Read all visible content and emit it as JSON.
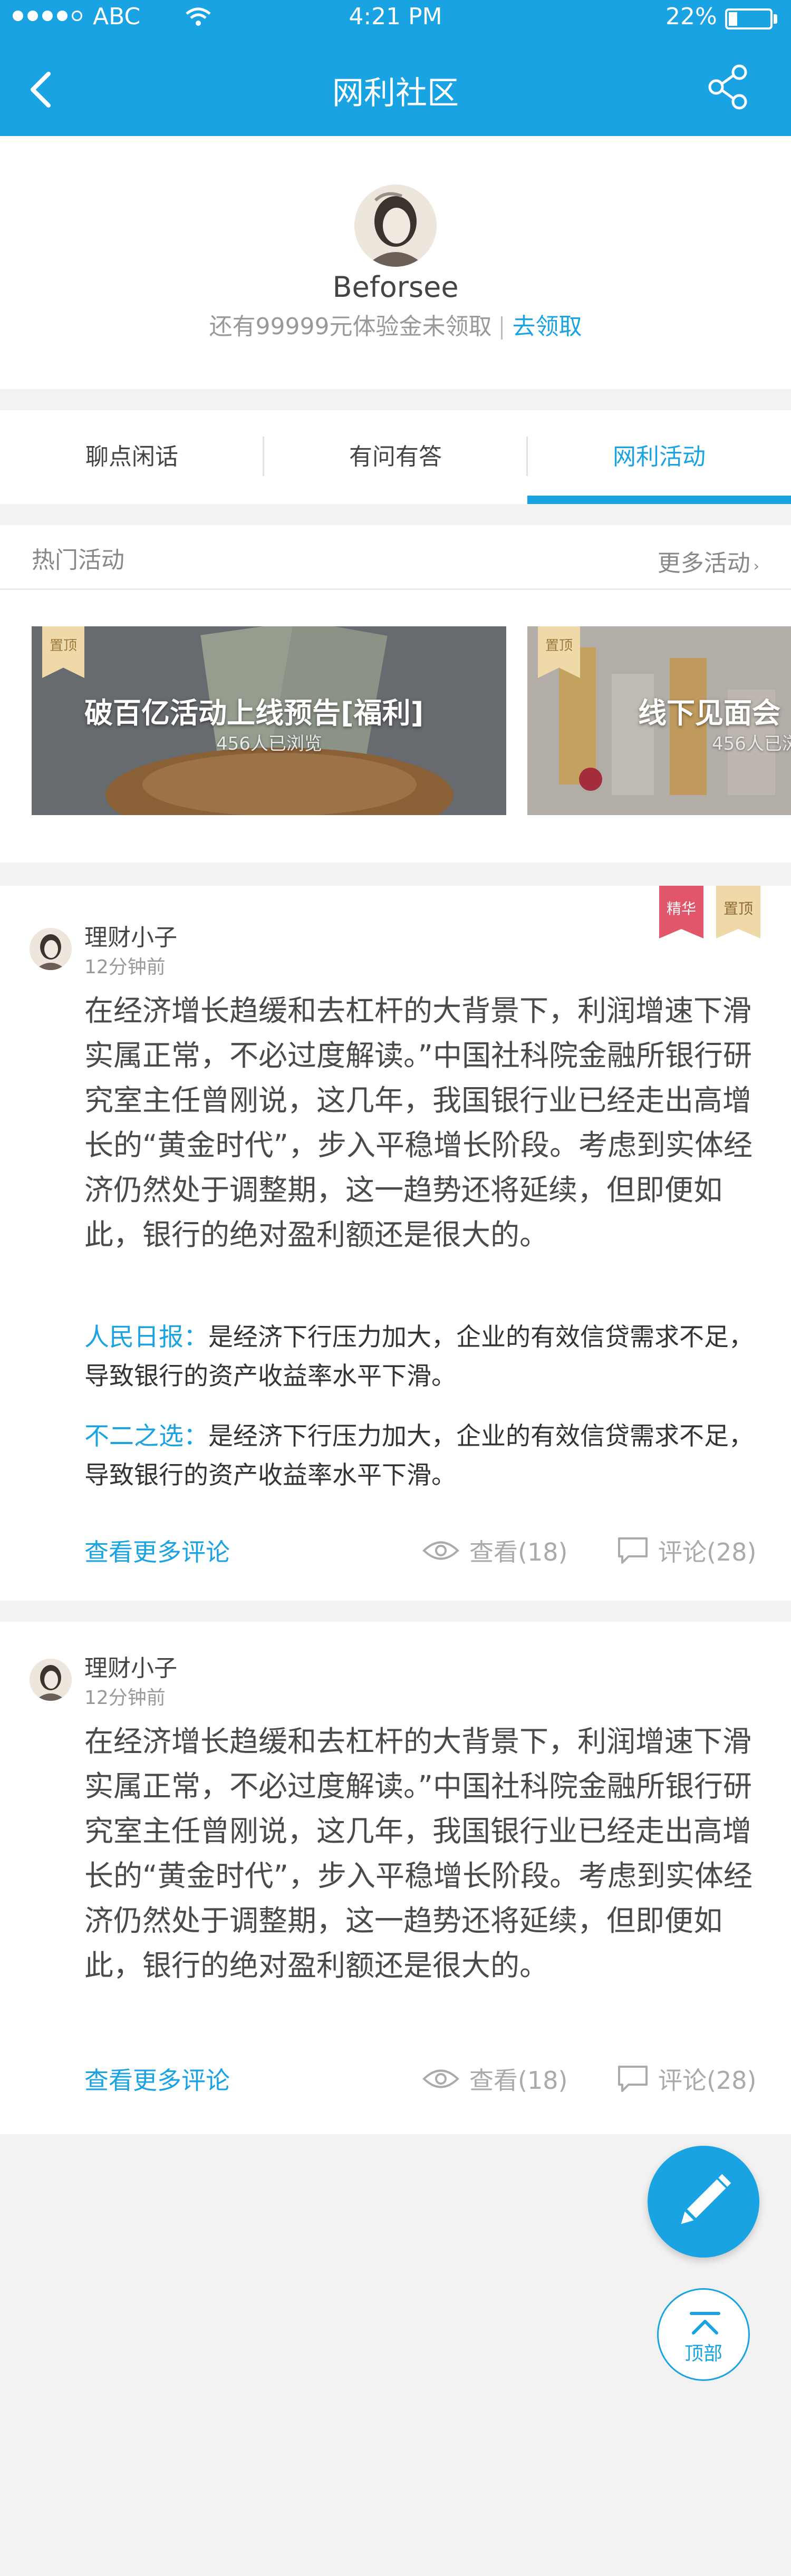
{
  "status_bar": {
    "carrier": "ABC",
    "time": "4:21 PM",
    "battery": "22%"
  },
  "nav": {
    "title": "网利社区"
  },
  "profile": {
    "username": "Beforsee",
    "promo_text": "还有99999元体验金未领取",
    "promo_link": "去领取"
  },
  "tabs": [
    {
      "label": "聊点闲话"
    },
    {
      "label": "有问有答"
    },
    {
      "label": "网利活动"
    }
  ],
  "active_tab": "网利活动",
  "hot": {
    "title": "热门活动",
    "more": "更多活动",
    "cards": [
      {
        "badge": "置顶",
        "title": "破百亿活动上线预告[福利]",
        "views": "456人已浏览"
      },
      {
        "badge": "置顶",
        "title": "线下见面会",
        "views": "456人已浏"
      }
    ]
  },
  "posts": [
    {
      "author": "理财小子",
      "time": "12分钟前",
      "flags": [
        "精华",
        "置顶"
      ],
      "body": "在经济增长趋缓和去杠杆的大背景下，利润增速下滑实属正常，不必过度解读。”中国社科院金融所银行研究室主任曾刚说，这几年，我国银行业已经走出高增长的“黄金时代”，步入平稳增长阶段。考虑到实体经济仍然处于调整期，这一趋势还将延续，但即便如此，银行的绝对盈利额还是很大的。",
      "comments": [
        {
          "name": "人民日报：",
          "text": "是经济下行压力加大，企业的有效信贷需求不足，导致银行的资产收益率水平下滑。"
        },
        {
          "name": "不二之选：",
          "text": "是经济下行压力加大，企业的有效信贷需求不足，导致银行的资产收益率水平下滑。"
        }
      ],
      "more_label": "查看更多评论",
      "views": "查看(18)",
      "comment_count": "评论(28)"
    },
    {
      "author": "理财小子",
      "time": "12分钟前",
      "body": "在经济增长趋缓和去杠杆的大背景下，利润增速下滑实属正常，不必过度解读。”中国社科院金融所银行研究室主任曾刚说，这几年，我国银行业已经走出高增长的“黄金时代”，步入平稳增长阶段。考虑到实体经济仍然处于调整期，这一趋势还将延续，但即便如此，银行的绝对盈利额还是很大的。",
      "more_label": "查看更多评论",
      "views": "查看(18)",
      "comment_count": "评论(28)"
    }
  ],
  "fab": {
    "top_label": "顶部"
  },
  "colors": {
    "accent": "#1aa3e3",
    "best_flag": "#e2566a",
    "top_flag": "#f0d9a8",
    "background": "#f2f2f2"
  }
}
